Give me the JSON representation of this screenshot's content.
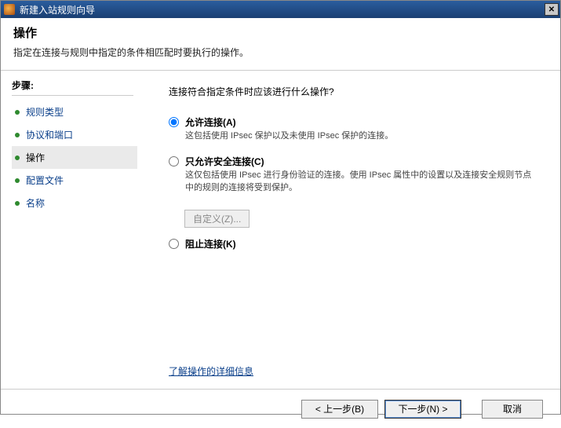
{
  "window": {
    "title": "新建入站规则向导"
  },
  "header": {
    "title": "操作",
    "subtitle": "指定在连接与规则中指定的条件相匹配时要执行的操作。"
  },
  "sidebar": {
    "heading": "步骤:",
    "items": [
      {
        "label": "规则类型",
        "active": false
      },
      {
        "label": "协议和端口",
        "active": false
      },
      {
        "label": "操作",
        "active": true
      },
      {
        "label": "配置文件",
        "active": false
      },
      {
        "label": "名称",
        "active": false
      }
    ]
  },
  "main": {
    "prompt": "连接符合指定条件时应该进行什么操作?",
    "options": [
      {
        "id": "allow",
        "label": "允许连接(A)",
        "desc": "这包括使用 IPsec 保护以及未使用 IPsec 保护的连接。",
        "checked": true
      },
      {
        "id": "secure",
        "label": "只允许安全连接(C)",
        "desc": "这仅包括使用 IPsec 进行身份验证的连接。使用 IPsec 属性中的设置以及连接安全规则节点中的规则的连接将受到保护。",
        "checked": false
      },
      {
        "id": "block",
        "label": "阻止连接(K)",
        "desc": "",
        "checked": false
      }
    ],
    "customize_button": "自定义(Z)...",
    "learn_link": "了解操作的详细信息"
  },
  "footer": {
    "back": "< 上一步(B)",
    "next": "下一步(N) >",
    "cancel": "取消"
  }
}
